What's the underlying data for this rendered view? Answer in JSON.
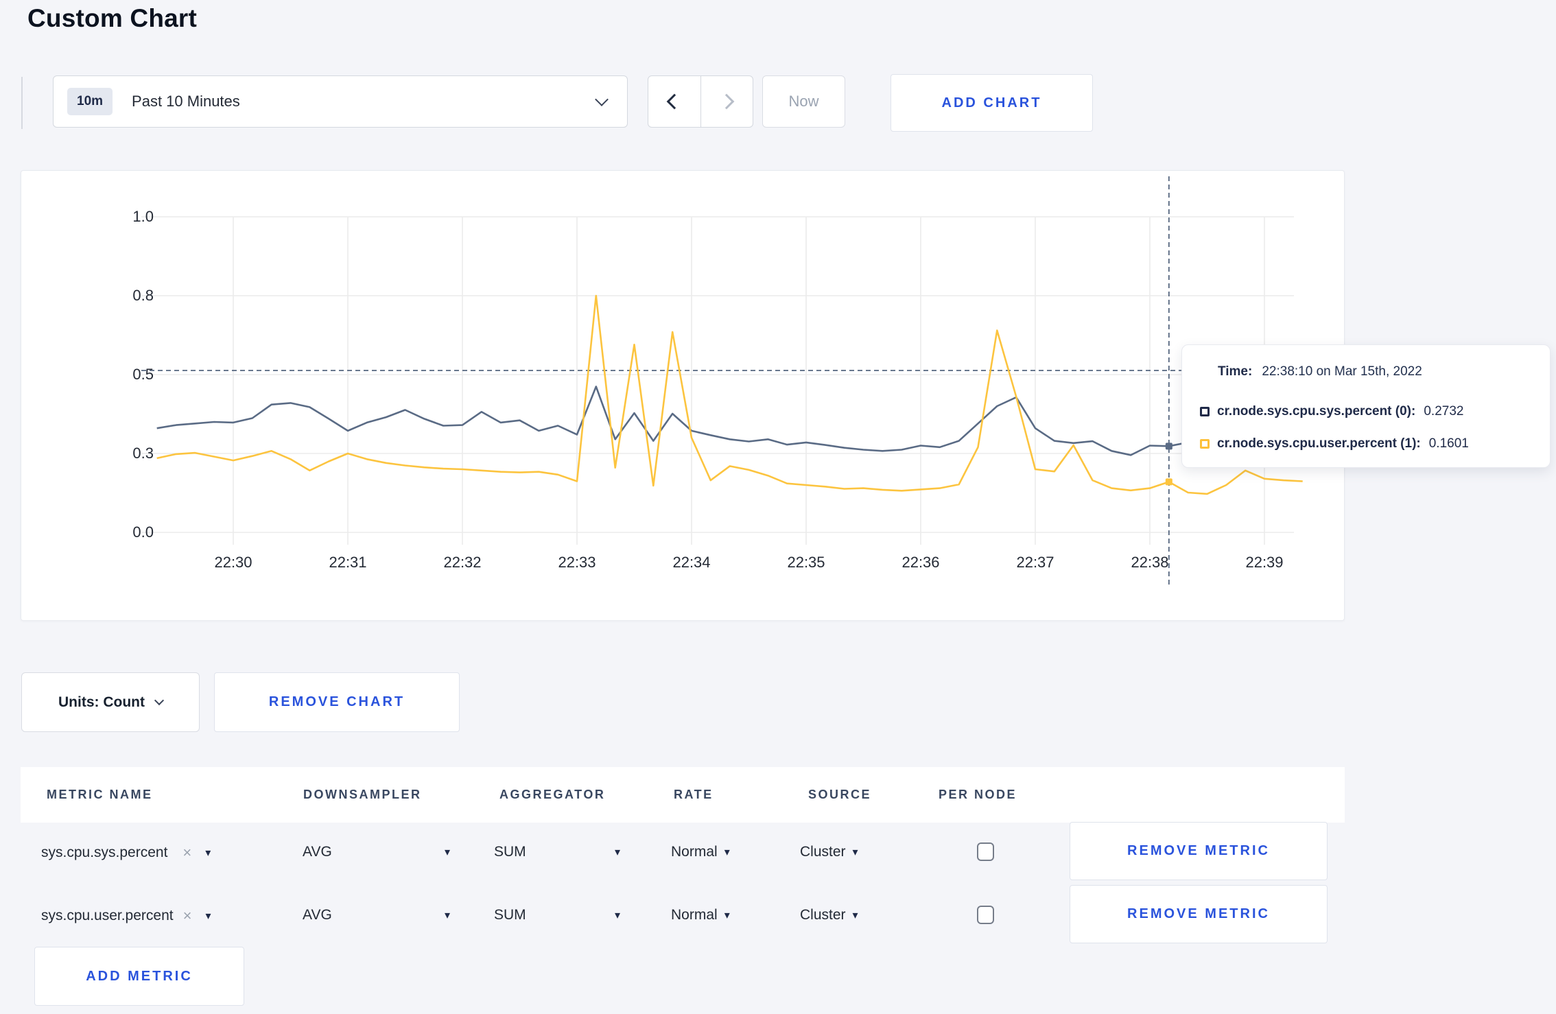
{
  "window": {
    "title": "Custom Chart"
  },
  "toolbar": {
    "time_selector": {
      "badge": "10m",
      "label": "Past 10 Minutes"
    },
    "now_button": "Now",
    "add_chart_button": "ADD CHART"
  },
  "chart_controls": {
    "units_button": "Units: Count",
    "remove_chart_button": "REMOVE CHART"
  },
  "tooltip": {
    "time_label": "Time:",
    "time_value": "22:38:10 on Mar 15th, 2022",
    "series": [
      {
        "label": "cr.node.sys.cpu.sys.percent (0):",
        "value": "0.2732",
        "swatch_color": "#1f2a48"
      },
      {
        "label": "cr.node.sys.cpu.user.percent (1):",
        "value": "0.1601",
        "swatch_color": "#fdc13b"
      }
    ]
  },
  "metrics_table": {
    "headers": [
      "METRIC NAME",
      "DOWNSAMPLER",
      "AGGREGATOR",
      "RATE",
      "SOURCE",
      "PER NODE"
    ],
    "rows": [
      {
        "metric_name": "sys.cpu.sys.percent",
        "downsampler": "AVG",
        "aggregator": "SUM",
        "rate": "Normal",
        "source": "Cluster",
        "per_node_checked": false,
        "remove_button": "REMOVE METRIC"
      },
      {
        "metric_name": "sys.cpu.user.percent",
        "downsampler": "AVG",
        "aggregator": "SUM",
        "rate": "Normal",
        "source": "Cluster",
        "per_node_checked": false,
        "remove_button": "REMOVE METRIC"
      }
    ],
    "add_metric_button": "ADD METRIC"
  },
  "icons": {
    "close": "×",
    "caret_down": "▾"
  },
  "colors": {
    "accent_blue": "#2a53dc",
    "navy_text": "#1f2a48",
    "series_sys": "#5a6b85",
    "series_user": "#fcc43f",
    "grid": "#ebebeb",
    "crosshair": "#54657e",
    "page_bg": "#f4f5f9"
  },
  "chart_data": {
    "type": "line",
    "title": "",
    "xlabel": "",
    "ylabel": "",
    "ylim": [
      0,
      1
    ],
    "grid": true,
    "legend_position": "tooltip",
    "x_ticks": [
      "22:30",
      "22:31",
      "22:32",
      "22:33",
      "22:34",
      "22:35",
      "22:36",
      "22:37",
      "22:38",
      "22:39"
    ],
    "y_ticks": {
      "values": [
        1.0,
        0.75,
        0.5,
        0.25,
        0.0
      ],
      "labels": [
        "1.0",
        "0.8",
        "0.5",
        "0.3",
        "0.0"
      ]
    },
    "x_start_time": "22:29:20",
    "x_step_seconds": 10,
    "series": [
      {
        "name": "cr.node.sys.cpu.sys.percent (0)",
        "color": "#5a6b85",
        "hover_value": 0.2732,
        "values": [
          0.33,
          0.34,
          0.345,
          0.35,
          0.348,
          0.362,
          0.405,
          0.41,
          0.397,
          0.36,
          0.322,
          0.348,
          0.365,
          0.388,
          0.36,
          0.338,
          0.34,
          0.382,
          0.348,
          0.355,
          0.322,
          0.338,
          0.31,
          0.462,
          0.295,
          0.378,
          0.29,
          0.376,
          0.322,
          0.308,
          0.295,
          0.288,
          0.295,
          0.278,
          0.285,
          0.277,
          0.268,
          0.262,
          0.258,
          0.262,
          0.275,
          0.27,
          0.29,
          0.345,
          0.4,
          0.428,
          0.33,
          0.29,
          0.283,
          0.289,
          0.258,
          0.245,
          0.275,
          0.2732,
          0.285,
          0.3,
          0.287,
          0.292,
          0.3,
          0.295,
          0.293
        ]
      },
      {
        "name": "cr.node.sys.cpu.user.percent (1)",
        "color": "#fcc43f",
        "hover_value": 0.1601,
        "values": [
          0.235,
          0.248,
          0.252,
          0.24,
          0.228,
          0.242,
          0.258,
          0.232,
          0.196,
          0.225,
          0.25,
          0.232,
          0.22,
          0.212,
          0.206,
          0.202,
          0.2,
          0.196,
          0.192,
          0.19,
          0.192,
          0.183,
          0.162,
          0.75,
          0.205,
          0.595,
          0.148,
          0.635,
          0.3,
          0.165,
          0.21,
          0.198,
          0.18,
          0.155,
          0.15,
          0.145,
          0.138,
          0.14,
          0.135,
          0.132,
          0.136,
          0.14,
          0.152,
          0.27,
          0.64,
          0.43,
          0.2,
          0.193,
          0.276,
          0.165,
          0.14,
          0.133,
          0.14,
          0.1601,
          0.126,
          0.122,
          0.15,
          0.196,
          0.17,
          0.165,
          0.162
        ]
      }
    ],
    "crosshair": {
      "time": "22:38:10",
      "seconds_from_2230": 490,
      "y_value": 0.513
    }
  }
}
